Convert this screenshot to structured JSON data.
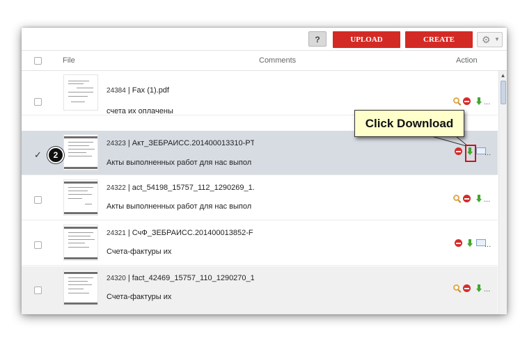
{
  "toolbar": {
    "help_label": "?",
    "upload_label": "UPLOAD",
    "create_label": "CREATE",
    "settings_icon": "gear-icon"
  },
  "table": {
    "columns": [
      "File",
      "Comments",
      "Action"
    ],
    "rows": [
      {
        "id": "24384",
        "sep": " | ",
        "name": "Fax (1).pdf",
        "comment": "счета их оплачены",
        "actions": [
          "view",
          "delete",
          "download",
          "more"
        ],
        "selected": false
      },
      {
        "id": "24323",
        "sep": " | ",
        "name": "Акт_ЗЕБРАИСС.201400013310-PT",
        "comment": "Акты выполненных работ для нас выпол",
        "actions": [
          "delete",
          "download",
          "email",
          "more"
        ],
        "selected": true
      },
      {
        "id": "24322",
        "sep": " | ",
        "name": "act_54198_15757_112_1290269_1.",
        "comment": "Акты выполненных работ для нас выпол",
        "actions": [
          "view",
          "delete",
          "download",
          "more"
        ],
        "selected": false
      },
      {
        "id": "24321",
        "sep": " | ",
        "name": "СчФ_ЗЕБРАИСС.201400013852-F",
        "comment": "Счета-фактуры их",
        "actions": [
          "delete",
          "download",
          "email",
          "more"
        ],
        "selected": false
      },
      {
        "id": "24320",
        "sep": " | ",
        "name": "fact_42469_15757_110_1290270_1",
        "comment": "Счета-фактуры их",
        "actions": [
          "view",
          "delete",
          "download",
          "more"
        ],
        "selected": false
      }
    ]
  },
  "more_label": "...",
  "annotation": {
    "callout": "Click Download",
    "step_number": "2",
    "check_glyph": "✓"
  },
  "colors": {
    "primary_button": "#d42a25",
    "selected_row": "#d7dce3",
    "callout_bg": "#ffffcc",
    "highlight": "#c8141a"
  }
}
